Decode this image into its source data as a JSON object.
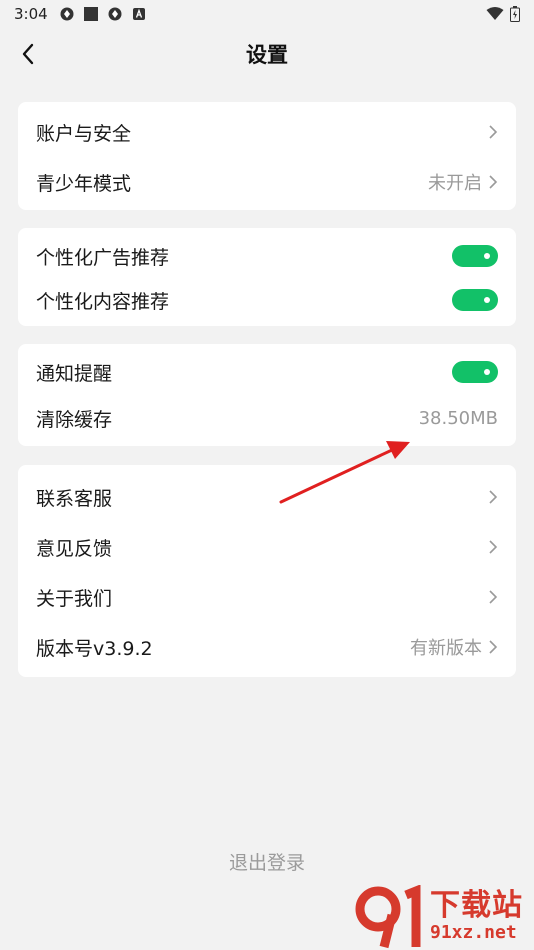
{
  "status_bar": {
    "time": "3:04",
    "left_icons": [
      "app-notification-icon",
      "square-notification-icon",
      "app-notification-icon",
      "keyboard-a-icon"
    ],
    "right_icons": [
      "wifi-icon",
      "battery-charging-icon"
    ]
  },
  "header": {
    "title": "设置",
    "back_icon": "chevron-left-icon"
  },
  "groups": [
    {
      "items": [
        {
          "label": "账户与安全",
          "value": "",
          "control": "chevron"
        },
        {
          "label": "青少年模式",
          "value": "未开启",
          "control": "chevron"
        }
      ]
    },
    {
      "items": [
        {
          "label": "个性化广告推荐",
          "control": "toggle",
          "on": true
        },
        {
          "label": "个性化内容推荐",
          "control": "toggle",
          "on": true
        }
      ]
    },
    {
      "items": [
        {
          "label": "通知提醒",
          "control": "toggle",
          "on": true
        },
        {
          "label": "清除缓存",
          "value": "38.50MB",
          "control": "value"
        }
      ]
    },
    {
      "items": [
        {
          "label": "联系客服",
          "value": "",
          "control": "chevron"
        },
        {
          "label": "意见反馈",
          "value": "",
          "control": "chevron"
        },
        {
          "label": "关于我们",
          "value": "",
          "control": "chevron"
        },
        {
          "label": "版本号v3.9.2",
          "value": "有新版本",
          "control": "chevron"
        }
      ]
    }
  ],
  "logout_label": "退出登录",
  "annotation": {
    "color": "#e02020"
  },
  "watermark": {
    "main": "下载站",
    "url": "91xz.net",
    "color": "#d63a2d"
  },
  "colors": {
    "toggle_on": "#12c168",
    "background": "#f2f2f2",
    "card": "#ffffff"
  }
}
